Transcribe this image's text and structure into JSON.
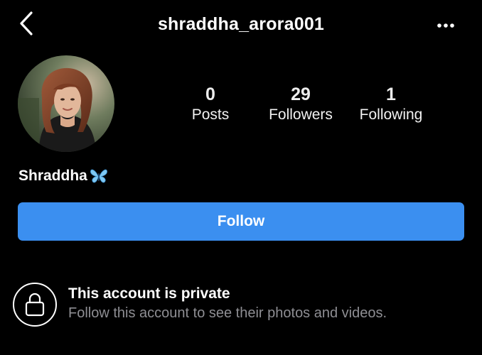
{
  "header": {
    "username": "shraddha_arora001",
    "back_icon": "chevron-left-icon",
    "more_icon": "ellipsis-icon"
  },
  "profile": {
    "display_name": "Shraddha",
    "name_emoji_icon": "butterfly-icon",
    "stats": [
      {
        "value": "0",
        "label": "Posts"
      },
      {
        "value": "29",
        "label": "Followers"
      },
      {
        "value": "1",
        "label": "Following"
      }
    ]
  },
  "actions": {
    "follow_label": "Follow",
    "accent_color": "#3b8ff0"
  },
  "privacy": {
    "icon": "lock-icon",
    "title": "This account is private",
    "subtitle": "Follow this account to see their photos and videos."
  }
}
